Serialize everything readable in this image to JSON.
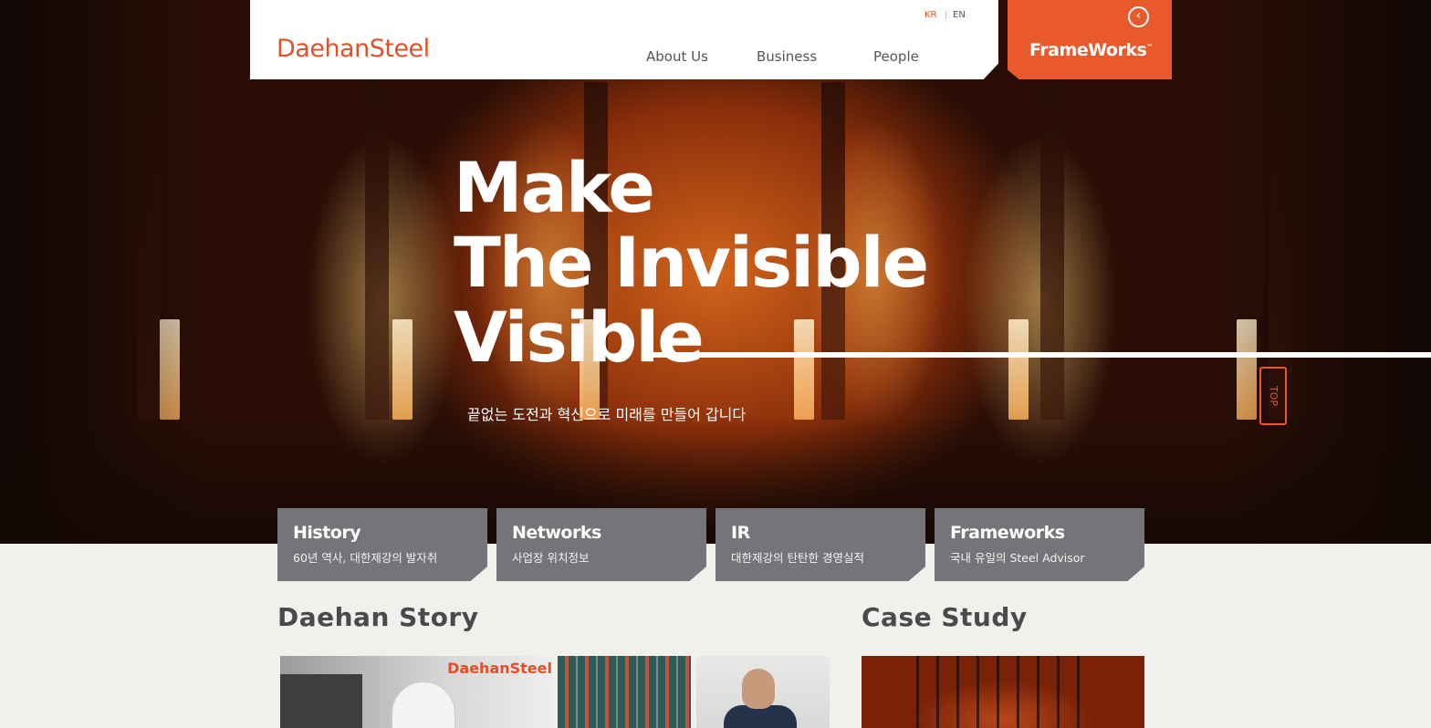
{
  "header": {
    "logo": "DaehanSteel",
    "lang": {
      "kr": "KR",
      "separator": "|",
      "en": "EN"
    },
    "nav": [
      "About Us",
      "Business",
      "People"
    ],
    "frameworks": {
      "label": "FrameWorks",
      "tm": "™",
      "back_icon": "‹"
    }
  },
  "hero": {
    "title_line1": "Make",
    "title_line2": "The Invisible",
    "title_line3": "Visible",
    "subtitle": "끝없는 도전과 혁신으로 미래를 만들어 갑니다",
    "top_button": "TOP"
  },
  "cards": [
    {
      "title": "History",
      "subtitle": "60년 역사, 대한제강의 발자취"
    },
    {
      "title": "Networks",
      "subtitle": "사업장 위치정보"
    },
    {
      "title": "IR",
      "subtitle": "대한제강의 탄탄한 경영실적"
    },
    {
      "title": "Frameworks",
      "subtitle": "국내 유일의 Steel Advisor"
    }
  ],
  "sections": {
    "story_title": "Daehan Story",
    "case_title": "Case Study",
    "story_thumb_brand": "DaehanSteel"
  },
  "colors": {
    "accent": "#e85a2c",
    "card_bg": "#737578",
    "page_bg": "#f1f0ec"
  }
}
